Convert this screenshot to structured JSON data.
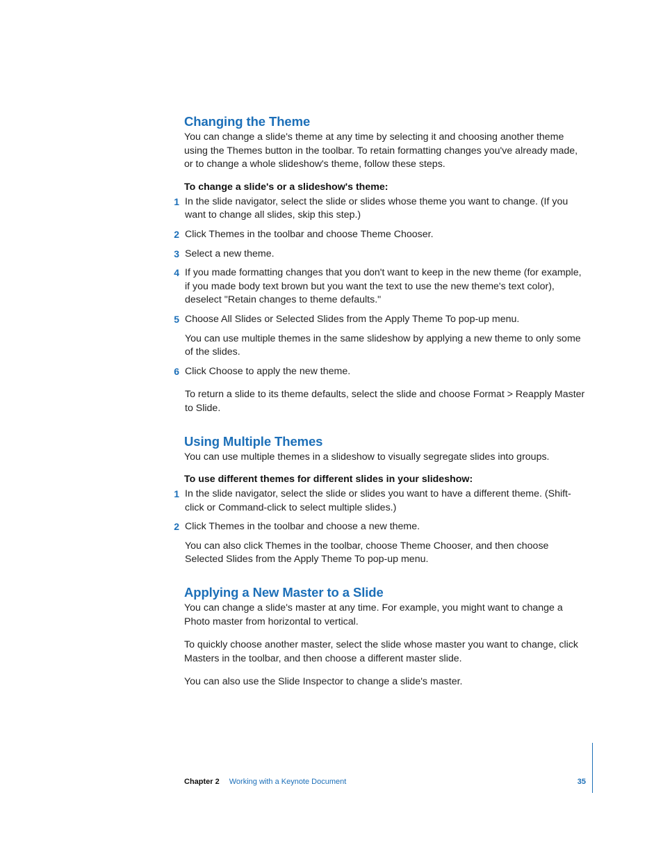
{
  "section1": {
    "heading": "Changing the Theme",
    "intro": "You can change a slide's theme at any time by selecting it and choosing another theme using the Themes button in the toolbar. To retain formatting changes you've already made, or to change a whole slideshow's theme, follow these steps.",
    "subhead": "To change a slide's or a slideshow's theme:",
    "steps": [
      {
        "n": "1",
        "t": "In the slide navigator, select the slide or slides whose theme you want to change. (If you want to change all slides, skip this step.)"
      },
      {
        "n": "2",
        "t": "Click Themes in the toolbar and choose Theme Chooser."
      },
      {
        "n": "3",
        "t": "Select a new theme."
      },
      {
        "n": "4",
        "t": "If you made formatting changes that you don't want to keep in the new theme (for example, if you made body text brown but you want the text to use the new theme's text color), deselect \"Retain changes to theme defaults.\""
      },
      {
        "n": "5",
        "t": "Choose All Slides or Selected Slides from the Apply Theme To pop-up menu.",
        "f": "You can use multiple themes in the same slideshow by applying a new theme to only some of the slides."
      },
      {
        "n": "6",
        "t": "Click Choose to apply the new theme.",
        "f": "To return a slide to its theme defaults, select the slide and choose Format > Reapply Master to Slide."
      }
    ]
  },
  "section2": {
    "heading": "Using Multiple Themes",
    "intro": "You can use multiple themes in a slideshow to visually segregate slides into groups.",
    "subhead": "To use different themes for different slides in your slideshow:",
    "steps": [
      {
        "n": "1",
        "t": "In the slide navigator, select the slide or slides you want to have a different theme. (Shift-click or Command-click to select multiple slides.)"
      },
      {
        "n": "2",
        "t": "Click Themes in the toolbar and choose a new theme.",
        "f": "You can also click Themes in the toolbar, choose Theme Chooser, and then choose Selected Slides from the Apply Theme To pop-up menu."
      }
    ]
  },
  "section3": {
    "heading": "Applying a New Master to a Slide",
    "p1": "You can change a slide's master at any time. For example, you might want to change a Photo master from horizontal to vertical.",
    "p2": "To quickly choose another master, select the slide whose master you want to change, click Masters in the toolbar, and then choose a different master slide.",
    "p3": "You can also use the Slide Inspector to change a slide's master."
  },
  "footer": {
    "chapter": "Chapter 2",
    "title": "Working with a Keynote Document",
    "page": "35"
  }
}
